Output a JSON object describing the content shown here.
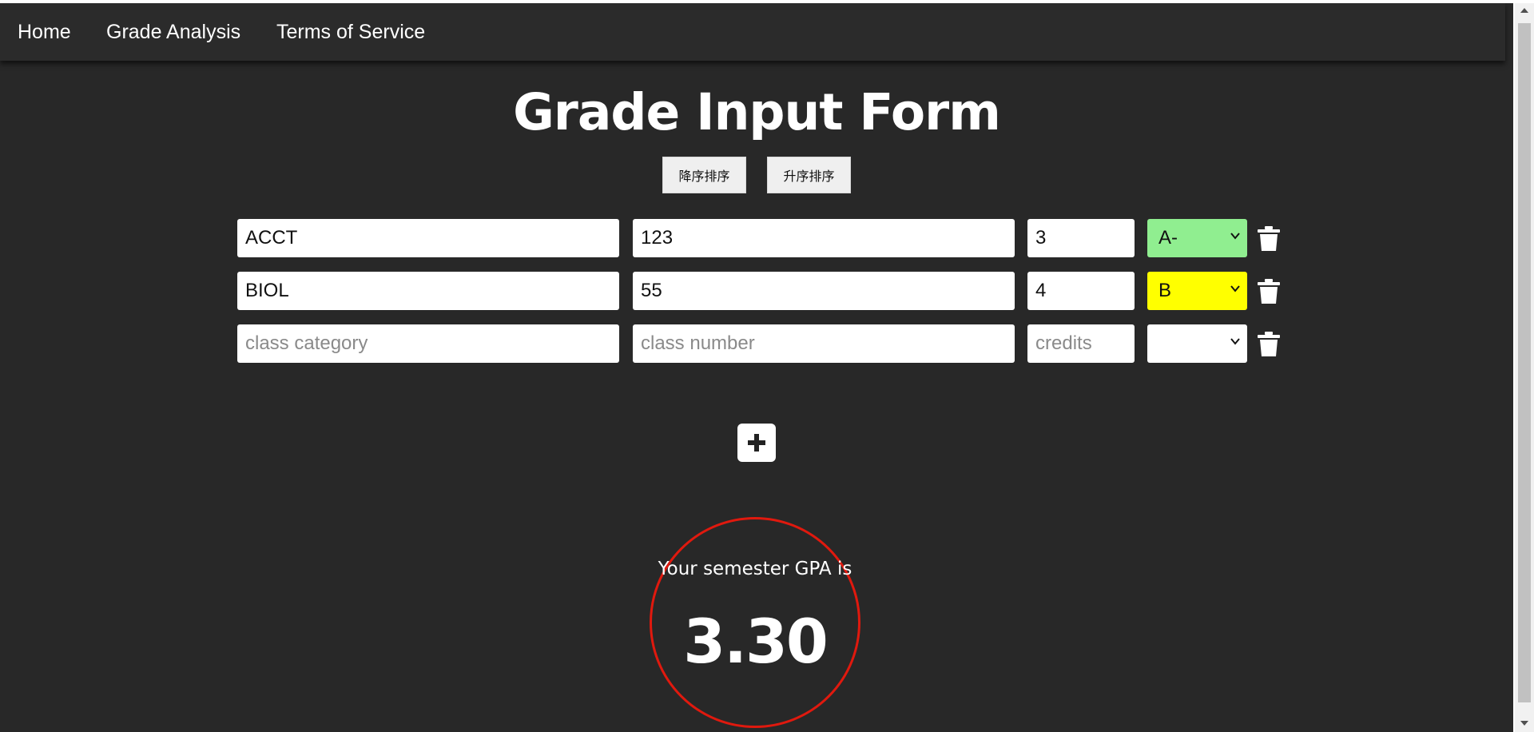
{
  "nav": {
    "links": [
      {
        "label": "Home"
      },
      {
        "label": "Grade Analysis"
      },
      {
        "label": "Terms of Service"
      }
    ]
  },
  "page": {
    "title": "Grade Input Form"
  },
  "sort": {
    "descending_label": "降序排序",
    "ascending_label": "升序排序"
  },
  "placeholders": {
    "category": "class category",
    "number": "class number",
    "credits": "credits"
  },
  "courses": [
    {
      "category": "ACCT",
      "number": "123",
      "credits": "3",
      "grade": "A-",
      "grade_color": "#90ee90"
    },
    {
      "category": "BIOL",
      "number": "55",
      "credits": "4",
      "grade": "B",
      "grade_color": "#ffff00"
    },
    {
      "category": "",
      "number": "",
      "credits": "",
      "grade": "",
      "grade_color": "#ffffff"
    }
  ],
  "icons": {
    "delete": "trash-icon",
    "add": "plus-icon",
    "dropdown": "chevron-down-icon"
  },
  "gpa": {
    "label": "Your semester GPA is",
    "value": "3.30",
    "ring_color": "#e0190e"
  },
  "colors": {
    "background": "#282828",
    "navbar": "#2b2b2b"
  }
}
